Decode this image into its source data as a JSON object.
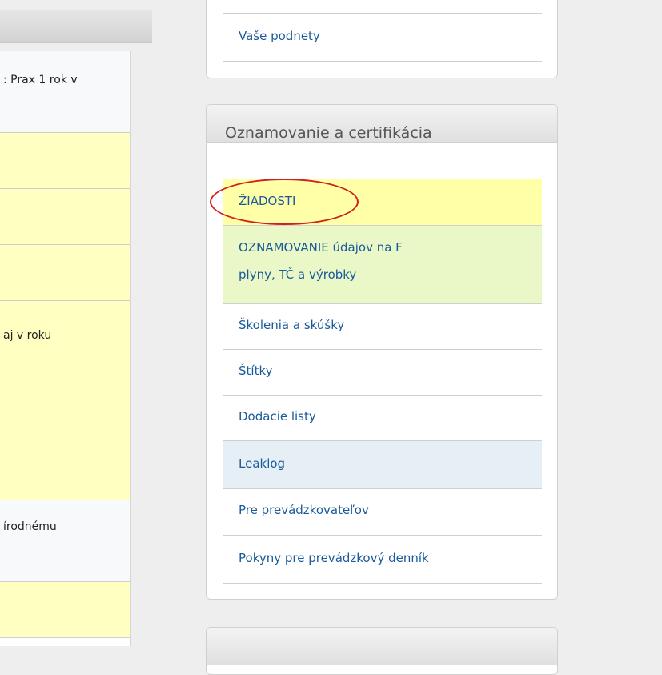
{
  "left_panel": {
    "rows": [
      {
        "text": ": Prax 1 rok v"
      },
      {
        "text": ""
      },
      {
        "text": ""
      },
      {
        "text": ""
      },
      {
        "text": "aj v roku"
      },
      {
        "text": ""
      },
      {
        "text": ""
      },
      {
        "text": "írodnému"
      },
      {
        "text": ""
      }
    ]
  },
  "top_box": {
    "item_label": "Vaše podnety"
  },
  "certification_box": {
    "title": "Oznamovanie a certifikácia",
    "items": [
      {
        "label": "ŽIADOSTI"
      },
      {
        "label_line1": "OZNAMOVANIE údajov na F",
        "label_line2": "plyny, TČ a výrobky"
      },
      {
        "label": "Školenia a skúšky"
      },
      {
        "label": "Štítky"
      },
      {
        "label": "Dodacie listy"
      },
      {
        "label": "Leaklog"
      },
      {
        "label": "Pre prevádzkovateľov"
      },
      {
        "label": "Pokyny pre prevádzkový denník"
      }
    ]
  },
  "colors": {
    "link": "#1a5a9a",
    "highlight_yellow": "#ffffa8",
    "highlight_green": "#eaf8c8",
    "highlight_blue": "#e5eff5",
    "annotation_red": "#d21e1e"
  }
}
